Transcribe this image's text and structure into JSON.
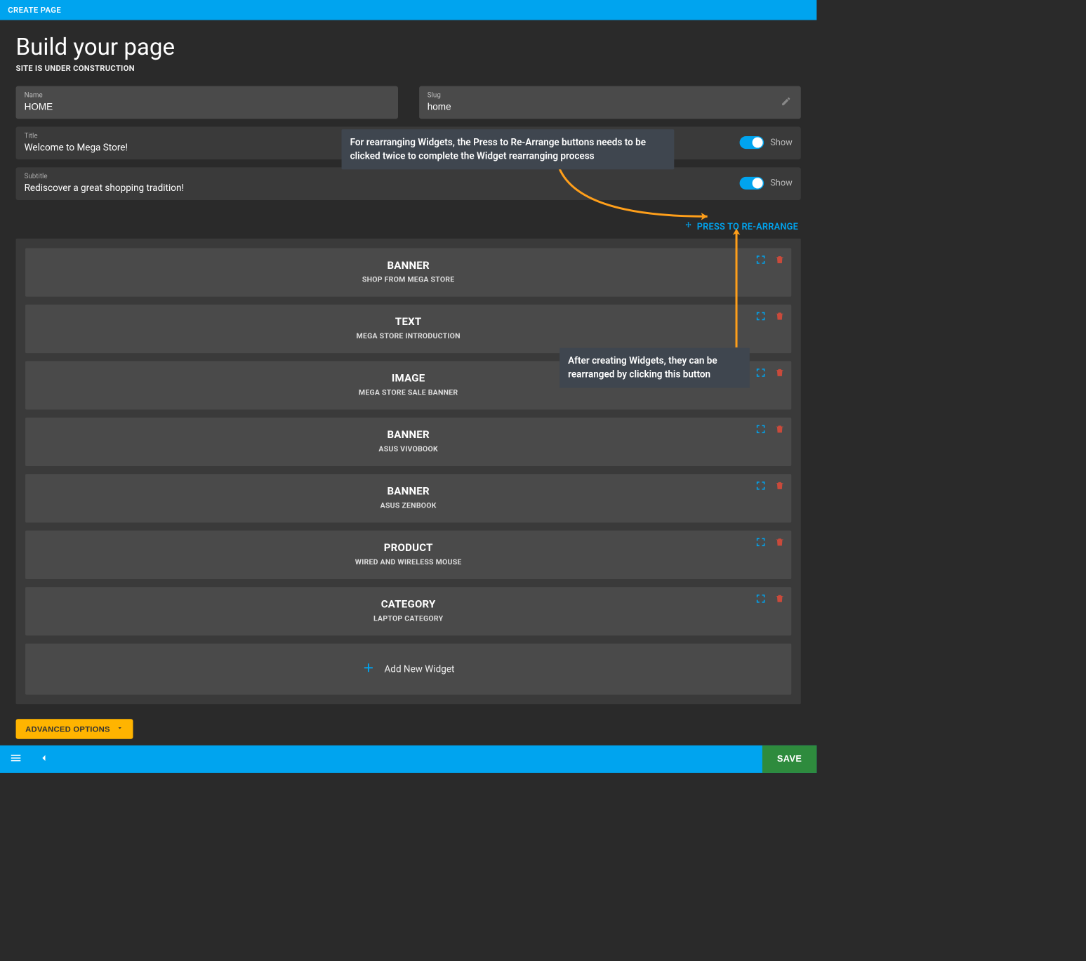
{
  "topbar": {
    "title": "CREATE PAGE"
  },
  "header": {
    "title": "Build your page",
    "subtitle": "SITE IS UNDER CONSTRUCTION"
  },
  "fields": {
    "name": {
      "label": "Name",
      "value": "HOME"
    },
    "slug": {
      "label": "Slug",
      "value": "home"
    },
    "title": {
      "label": "Title",
      "value": "Welcome to Mega Store!",
      "show_label": "Show"
    },
    "subtitle": {
      "label": "Subtitle",
      "value": "Rediscover a great shopping tradition!",
      "show_label": "Show"
    }
  },
  "rearrange": {
    "label": "PRESS TO RE-ARRANGE"
  },
  "widgets": [
    {
      "type": "BANNER",
      "subtitle": "SHOP FROM MEGA STORE"
    },
    {
      "type": "TEXT",
      "subtitle": "MEGA STORE INTRODUCTION"
    },
    {
      "type": "IMAGE",
      "subtitle": "MEGA STORE SALE BANNER"
    },
    {
      "type": "BANNER",
      "subtitle": "ASUS VIVOBOOK"
    },
    {
      "type": "BANNER",
      "subtitle": "ASUS ZENBOOK"
    },
    {
      "type": "PRODUCT",
      "subtitle": "WIRED AND WIRELESS MOUSE"
    },
    {
      "type": "CATEGORY",
      "subtitle": "LAPTOP CATEGORY"
    }
  ],
  "add_widget": {
    "label": "Add New Widget"
  },
  "advanced": {
    "label": "ADVANCED OPTIONS"
  },
  "bottombar": {
    "save": "SAVE"
  },
  "tooltips": {
    "t1": "For rearranging Widgets, the Press to Re-Arrange buttons needs to be clicked twice to complete the Widget rearranging process",
    "t2": "After creating Widgets, they can be rearranged by clicking this button"
  },
  "colors": {
    "accent": "#00a4ef",
    "warn": "#ffb400",
    "save": "#2e8b3d",
    "danger": "#c94a3b"
  }
}
